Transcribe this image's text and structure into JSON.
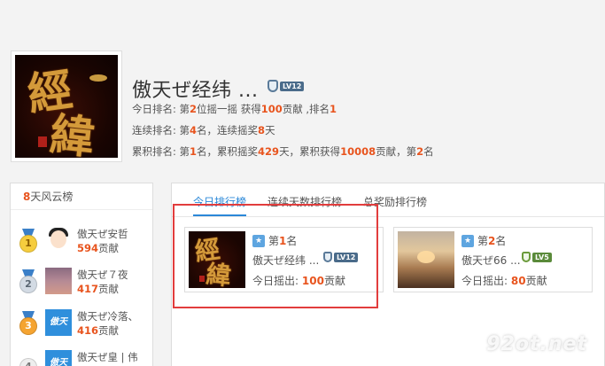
{
  "profile": {
    "name": "傲天ぜ经纬 ...",
    "level": "LV12",
    "avatar_text": [
      "經",
      "緯"
    ],
    "today_rank": {
      "label": "今日排名:",
      "pre": "第",
      "rank": "2",
      "mid1": "位摇一摇 获得",
      "gained": "100",
      "mid2": "贡献 ,排名",
      "rank2": "1"
    },
    "streak_rank": {
      "label": "连续排名:",
      "pre": "第",
      "rank": "4",
      "mid": "名，连续摇奖",
      "days": "8",
      "post": "天"
    },
    "total_rank": {
      "label": "累积排名:",
      "pre": "第",
      "rank": "1",
      "mid1": "名，累积摇奖",
      "days": "429",
      "mid2": "天，累积获得",
      "total": "10008",
      "mid3": "贡献，第",
      "rank2": "2",
      "post": "名"
    }
  },
  "left_panel": {
    "title_num": "8",
    "title_text": "天风云榜",
    "items": [
      {
        "rank": "1",
        "name": "傲天ぜ安哲",
        "score": "594",
        "unit": "贡献"
      },
      {
        "rank": "2",
        "name": "傲天ぜ７夜",
        "score": "417",
        "unit": "贡献"
      },
      {
        "rank": "3",
        "name": "傲天ぜ冷落、",
        "score": "416",
        "unit": "贡献",
        "thumb_text": "傲天"
      },
      {
        "rank": "4",
        "name": "傲天ぜ皇 | 伟",
        "thumb_text": "傲天"
      }
    ]
  },
  "tabs": [
    {
      "label": "今日排行榜",
      "active": true
    },
    {
      "label": "连续天数排行榜",
      "active": false
    },
    {
      "label": "总奖励排行榜",
      "active": false
    }
  ],
  "cards": [
    {
      "rank_pre": "第",
      "rank": "1",
      "rank_post": "名",
      "name": "傲天ぜ经纬 ...",
      "level": "LV12",
      "shake_label": "今日摇出:",
      "shake_value": "100",
      "shake_unit": "贡献",
      "avatar_text": [
        "經",
        "緯"
      ]
    },
    {
      "rank_pre": "第",
      "rank": "2",
      "rank_post": "名",
      "name": "傲天ぜ66 ...",
      "level": "LV5",
      "shake_label": "今日摇出:",
      "shake_value": "80",
      "shake_unit": "贡献"
    }
  ],
  "watermark": "92ot.net",
  "colors": {
    "accent": "#e8541e",
    "tab_active": "#2b88d8",
    "highlight": "#e23d3d"
  }
}
